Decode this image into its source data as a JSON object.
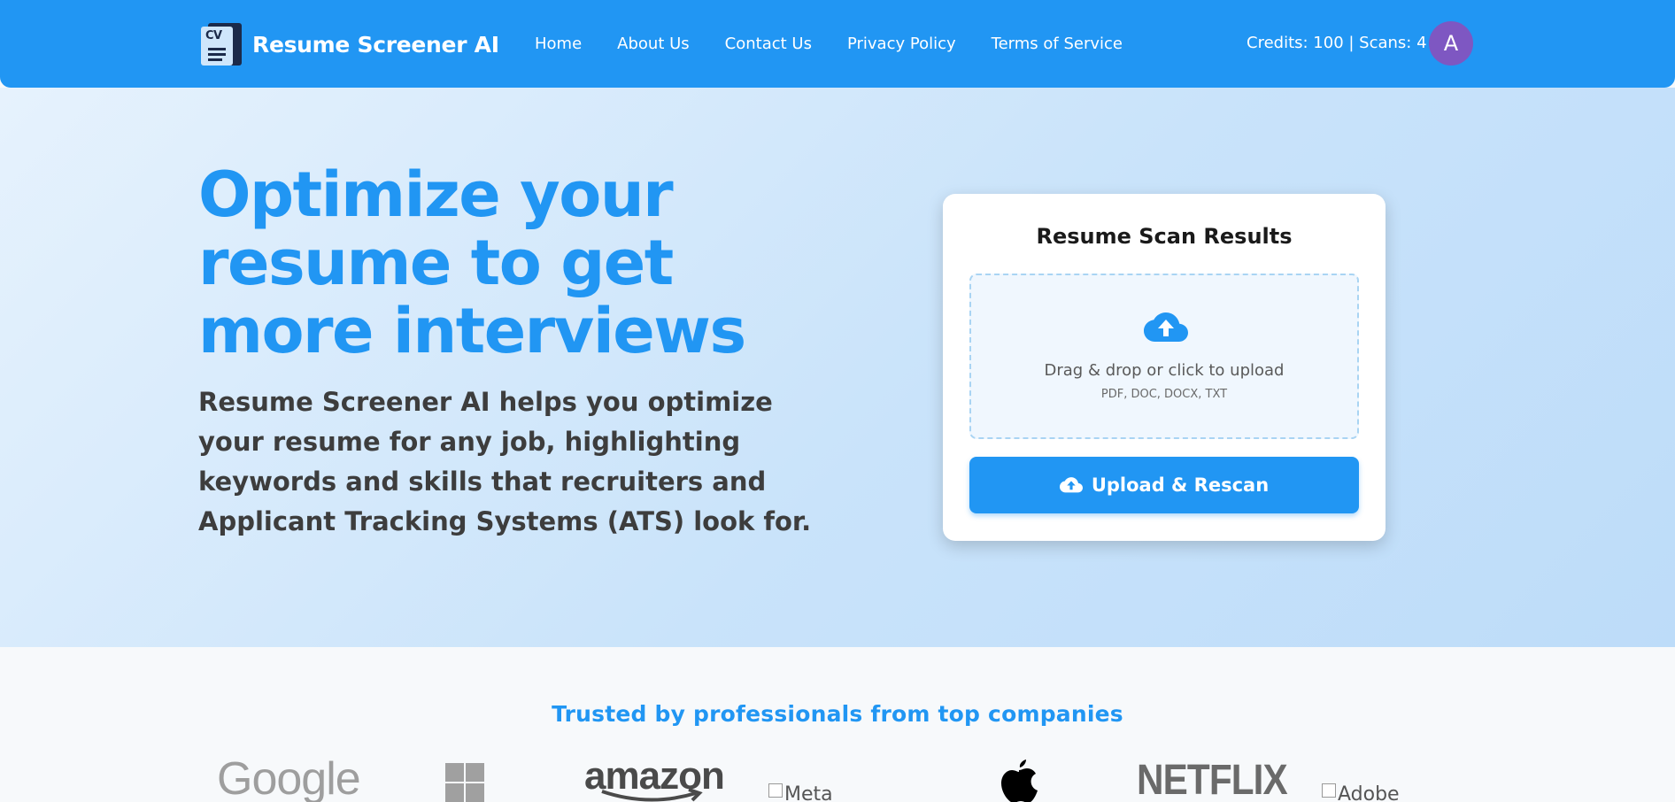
{
  "header": {
    "brand_logo_text": "CV",
    "brand_name": "Resume Screener AI",
    "nav": [
      "Home",
      "About Us",
      "Contact Us",
      "Privacy Policy",
      "Terms of Service"
    ],
    "credits_text": "Credits: 100 | Scans: 4",
    "avatar_initial": "A",
    "avatar_color": "#7e57c2",
    "accent_color": "#2196f3"
  },
  "hero": {
    "title": "Optimize your resume to get more interviews",
    "subtitle": "Resume Screener AI helps you optimize your resume for any job, highlighting keywords and skills that recruiters and Applicant Tracking Systems (ATS) look for."
  },
  "scan_card": {
    "title": "Resume Scan Results",
    "dropzone_icon": "cloud-upload-icon",
    "dropzone_text": "Drag & drop or click to upload",
    "dropzone_formats": "PDF, DOC, DOCX, TXT",
    "button_icon": "cloud-upload-icon",
    "button_label": "Upload & Rescan"
  },
  "trusted": {
    "title": "Trusted by professionals from top companies",
    "logos": {
      "google": "Google",
      "microsoft_icon": "microsoft-logo-icon",
      "amazon": "amazon",
      "meta_alt": "Meta",
      "apple_icon": "apple-logo-icon",
      "netflix": "NETFLIX",
      "adobe_alt": "Adobe"
    }
  }
}
